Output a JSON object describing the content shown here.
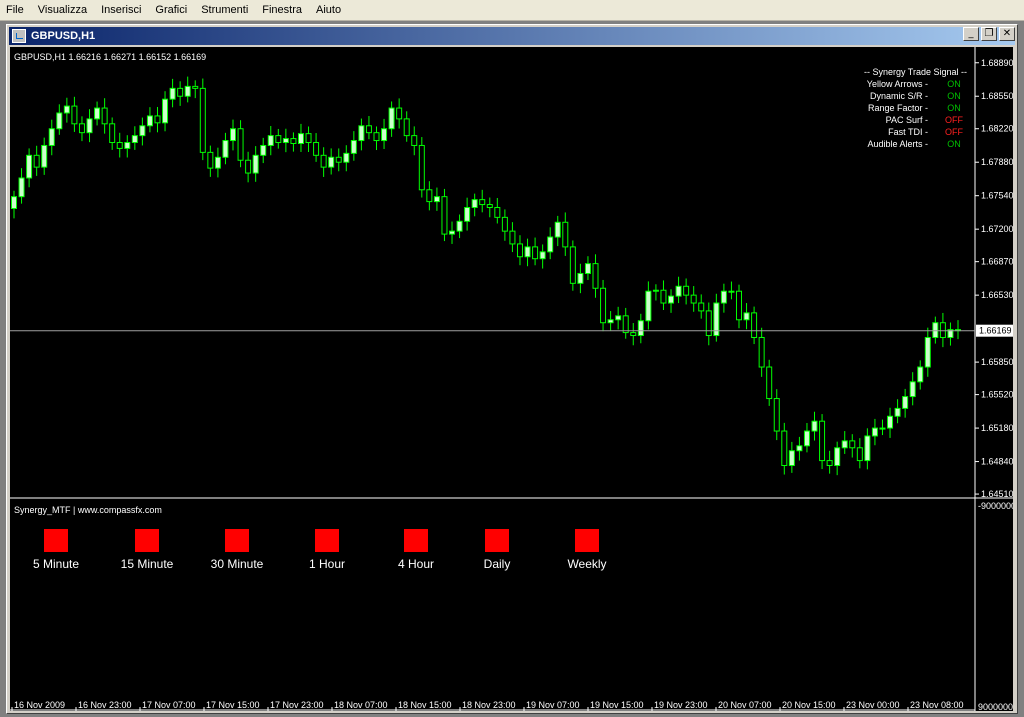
{
  "menu": [
    "File",
    "Visualizza",
    "Inserisci",
    "Grafici",
    "Strumenti",
    "Finestra",
    "Aiuto"
  ],
  "window": {
    "title": "GBPUSD,H1",
    "minimize": "_",
    "restore": "❐",
    "close": "✕"
  },
  "price_header": "GBPUSD,H1  1.66216 1.66271 1.66152 1.66169",
  "current_price": "1.66169",
  "signal_panel": {
    "title": "-- Synergy Trade Signal --",
    "rows": [
      {
        "label": "Yellow Arrows -",
        "value": "ON"
      },
      {
        "label": "Dynamic S/R -",
        "value": "ON"
      },
      {
        "label": "Range Factor -",
        "value": "ON"
      },
      {
        "label": "PAC Surf -",
        "value": "OFF"
      },
      {
        "label": "Fast TDI -",
        "value": "OFF"
      },
      {
        "label": "Audible Alerts -",
        "value": "ON"
      }
    ]
  },
  "indicator": {
    "title": "Synergy_MTF | www.compassfx.com",
    "timeframes": [
      "5 Minute",
      "15 Minute",
      "30 Minute",
      "1 Hour",
      "4 Hour",
      "Daily",
      "Weekly"
    ],
    "box_color": "#ff0000",
    "scale_top": "-9000000",
    "scale_bottom": "9000000"
  },
  "colors": {
    "bull": "#ccffcc",
    "wick": "#00ff00",
    "on": "#00c000",
    "off": "#ff2020",
    "grid_text": "#ffffff"
  },
  "chart_data": {
    "type": "candlestick",
    "symbol": "GBPUSD",
    "timeframe": "H1",
    "y_ticks": [
      1.6889,
      1.6855,
      1.6822,
      1.6788,
      1.6754,
      1.672,
      1.6687,
      1.6653,
      1.6585,
      1.6552,
      1.6518,
      1.6484,
      1.6451
    ],
    "y_tick_labels": [
      "1.68890",
      "1.68550",
      "1.68220",
      "1.67880",
      "1.67540",
      "1.67200",
      "1.66870",
      "1.66530",
      "1.65850",
      "1.65520",
      "1.65180",
      "1.64840",
      "1.64510"
    ],
    "ylim": [
      1.6447,
      1.6905
    ],
    "current": 1.66169,
    "x_labels": [
      "16 Nov 2009",
      "16 Nov 23:00",
      "17 Nov 07:00",
      "17 Nov 15:00",
      "17 Nov 23:00",
      "18 Nov 07:00",
      "18 Nov 15:00",
      "18 Nov 23:00",
      "19 Nov 07:00",
      "19 Nov 15:00",
      "19 Nov 23:00",
      "20 Nov 07:00",
      "20 Nov 15:00",
      "23 Nov 00:00",
      "23 Nov 08:00"
    ],
    "closes": [
      1.6753,
      1.6772,
      1.6795,
      1.6783,
      1.6805,
      1.6822,
      1.6838,
      1.6845,
      1.6827,
      1.6818,
      1.6832,
      1.6843,
      1.6827,
      1.6808,
      1.6802,
      1.6808,
      1.6815,
      1.6825,
      1.6835,
      1.6828,
      1.6852,
      1.6863,
      1.6855,
      1.6865,
      1.6863,
      1.6798,
      1.6782,
      1.6793,
      1.681,
      1.6822,
      1.679,
      1.6777,
      1.6795,
      1.6805,
      1.6815,
      1.6808,
      1.6812,
      1.6807,
      1.6817,
      1.6808,
      1.6795,
      1.6783,
      1.6793,
      1.6788,
      1.6797,
      1.681,
      1.6825,
      1.6818,
      1.681,
      1.6822,
      1.6843,
      1.6832,
      1.6815,
      1.6805,
      1.676,
      1.6748,
      1.6753,
      1.6715,
      1.6718,
      1.6728,
      1.6742,
      1.675,
      1.6745,
      1.6742,
      1.6732,
      1.6718,
      1.6705,
      1.6692,
      1.6702,
      1.669,
      1.6697,
      1.6712,
      1.6727,
      1.6702,
      1.6665,
      1.6675,
      1.6685,
      1.666,
      1.6625,
      1.6628,
      1.6632,
      1.6615,
      1.6612,
      1.6627,
      1.6657,
      1.6658,
      1.6645,
      1.6652,
      1.6662,
      1.6653,
      1.6645,
      1.6637,
      1.6612,
      1.6645,
      1.6657,
      1.6657,
      1.6628,
      1.6635,
      1.661,
      1.658,
      1.6548,
      1.6515,
      1.648,
      1.6495,
      1.65,
      1.6515,
      1.6525,
      1.6485,
      1.648,
      1.6498,
      1.6505,
      1.6498,
      1.6485,
      1.651,
      1.6518,
      1.6518,
      1.653,
      1.6538,
      1.655,
      1.6565,
      1.658,
      1.661,
      1.6625,
      1.661,
      1.6618,
      1.6617
    ]
  }
}
